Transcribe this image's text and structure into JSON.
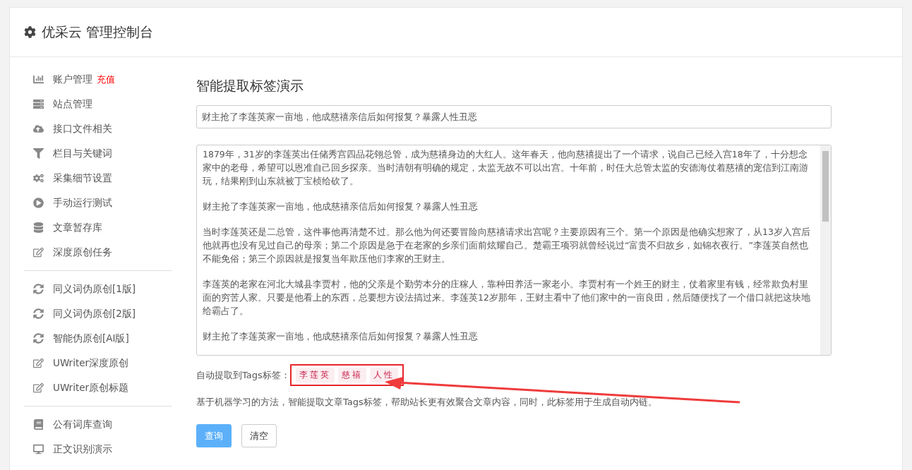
{
  "header": {
    "title": "优采云 管理控制台"
  },
  "sidebar": {
    "groups": [
      [
        {
          "kind": "chart",
          "label": "账户管理",
          "badge": "充值"
        },
        {
          "kind": "server",
          "label": "站点管理"
        },
        {
          "kind": "cloud",
          "label": "接口文件相关"
        },
        {
          "kind": "filter",
          "label": "栏目与关键词"
        },
        {
          "kind": "cogs",
          "label": "采集细节设置"
        },
        {
          "kind": "play",
          "label": "手动运行测试"
        },
        {
          "kind": "database",
          "label": "文章暂存库"
        },
        {
          "kind": "edit",
          "label": "深度原创任务"
        }
      ],
      [
        {
          "kind": "sync",
          "label": "同义词伪原创[1版]"
        },
        {
          "kind": "sync",
          "label": "同义词伪原创[2版]"
        },
        {
          "kind": "sync",
          "label": "智能伪原创[AI版]"
        },
        {
          "kind": "edit",
          "label": "UWriter深度原创"
        },
        {
          "kind": "edit",
          "label": "UWriter原创标题"
        }
      ],
      [
        {
          "kind": "book",
          "label": "公有词库查询"
        },
        {
          "kind": "monitor",
          "label": "正文识别演示"
        }
      ]
    ]
  },
  "main": {
    "title": "智能提取标签演示",
    "title_field": {
      "value": "财主抢了李莲英家一亩地，他成慈禧亲信后如何报复？暴露人性丑恶"
    },
    "content_paragraphs": [
      "1879年，31岁的李莲英出任储秀宫四品花翎总管，成为慈禧身边的大红人。这年春天，他向慈禧提出了一个请求，说自己已经入宫18年了，十分想念家中的老母，希望可以恩准自己回乡探亲。当时清朝有明确的规定，太监无故不可以出宫。十年前，时任大总管太监的安德海仗着慈禧的宠信到江南游玩，结果刚到山东就被丁宝桢给砍了。",
      "财主抢了李莲英家一亩地，他成慈禧亲信后如何报复？暴露人性丑恶",
      "当时李莲英还是二总管，这件事他再清楚不过。那么他为何还要冒险向慈禧请求出宫呢？主要原因有三个。第一个原因是他确实想家了，从13岁入宫后他就再也没有见过自己的母亲；第二个原因是急于在老家的乡亲们面前炫耀自己。楚霸王项羽就曾经说过“富贵不归故乡，如锦衣夜行。”李莲英自然也不能免俗；第三个原因就是报复当年欺压他们李家的王财主。",
      "李莲英的老家在河北大城县李贾村，他的父亲是个勤劳本分的庄稼人，靠种田养活一家老小。李贾村有一个姓王的财主，仗着家里有钱，经常欺负村里面的穷苦人家。只要是他看上的东西，总要想方设法搞过来。李莲英12岁那年，王财主看中了他们家中的一亩良田，然后随便找了一个借口就把这块地给霸占了。",
      "财主抢了李莲英家一亩地，他成慈禧亲信后如何报复？暴露人性丑恶"
    ],
    "tags_label": "自动提取到Tags标签：",
    "tags": [
      "李莲英",
      "慈禧",
      "人性"
    ],
    "description": "基于机器学习的方法，智能提取文章Tags标签，帮助站长更有效聚合文章内容，同时，此标签用于生成自动内链。",
    "buttons": [
      {
        "kind": "primary",
        "label": "查询"
      },
      {
        "kind": "default",
        "label": "清空"
      }
    ]
  }
}
